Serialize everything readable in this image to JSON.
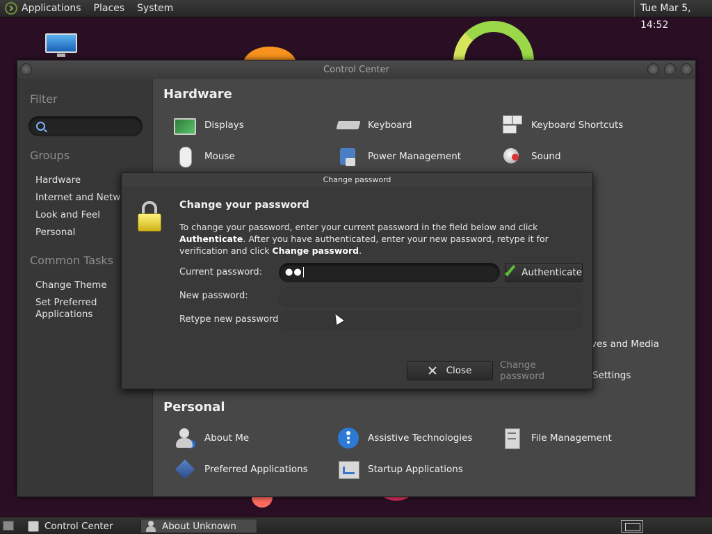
{
  "top_panel": {
    "menus": [
      "Applications",
      "Places",
      "System"
    ],
    "clock": "Tue Mar  5, 14:52"
  },
  "control_center": {
    "title": "Control Center",
    "sidebar": {
      "filter_label": "Filter",
      "search_value": "",
      "groups_label": "Groups",
      "groups": [
        "Hardware",
        "Internet and Network",
        "Look and Feel",
        "Personal"
      ],
      "tasks_label": "Common Tasks",
      "tasks": [
        "Change Theme",
        "Set Preferred Applications"
      ]
    },
    "hardware": {
      "heading": "Hardware",
      "items": [
        "Displays",
        "Keyboard",
        "Keyboard Shortcuts",
        "Mouse",
        "Power Management",
        "Sound"
      ]
    },
    "partial_items": [
      "ves and Media",
      "Settings"
    ],
    "personal": {
      "heading": "Personal",
      "items": [
        "About Me",
        "Assistive Technologies",
        "File Management",
        "Preferred Applications",
        "Startup Applications"
      ]
    }
  },
  "dialog": {
    "title": "Change password",
    "heading": "Change your password",
    "desc_1": "To change your password, enter your current password in the field below and click ",
    "desc_authenticate": "Authenticate",
    "desc_2": ". After you have authenticated, enter your new password, retype it for verification and click ",
    "desc_change": "Change password",
    "desc_3": ".",
    "current_label": "Current password:",
    "current_value": "●●",
    "new_label": "New password:",
    "new_value": "",
    "retype_label": "Retype new password:",
    "retype_value": "",
    "authenticate_button": "Authenticate",
    "close_button": "Close",
    "change_button": "Change password"
  },
  "bottom_panel": {
    "tasks": [
      "Control Center",
      "About Unknown"
    ]
  }
}
